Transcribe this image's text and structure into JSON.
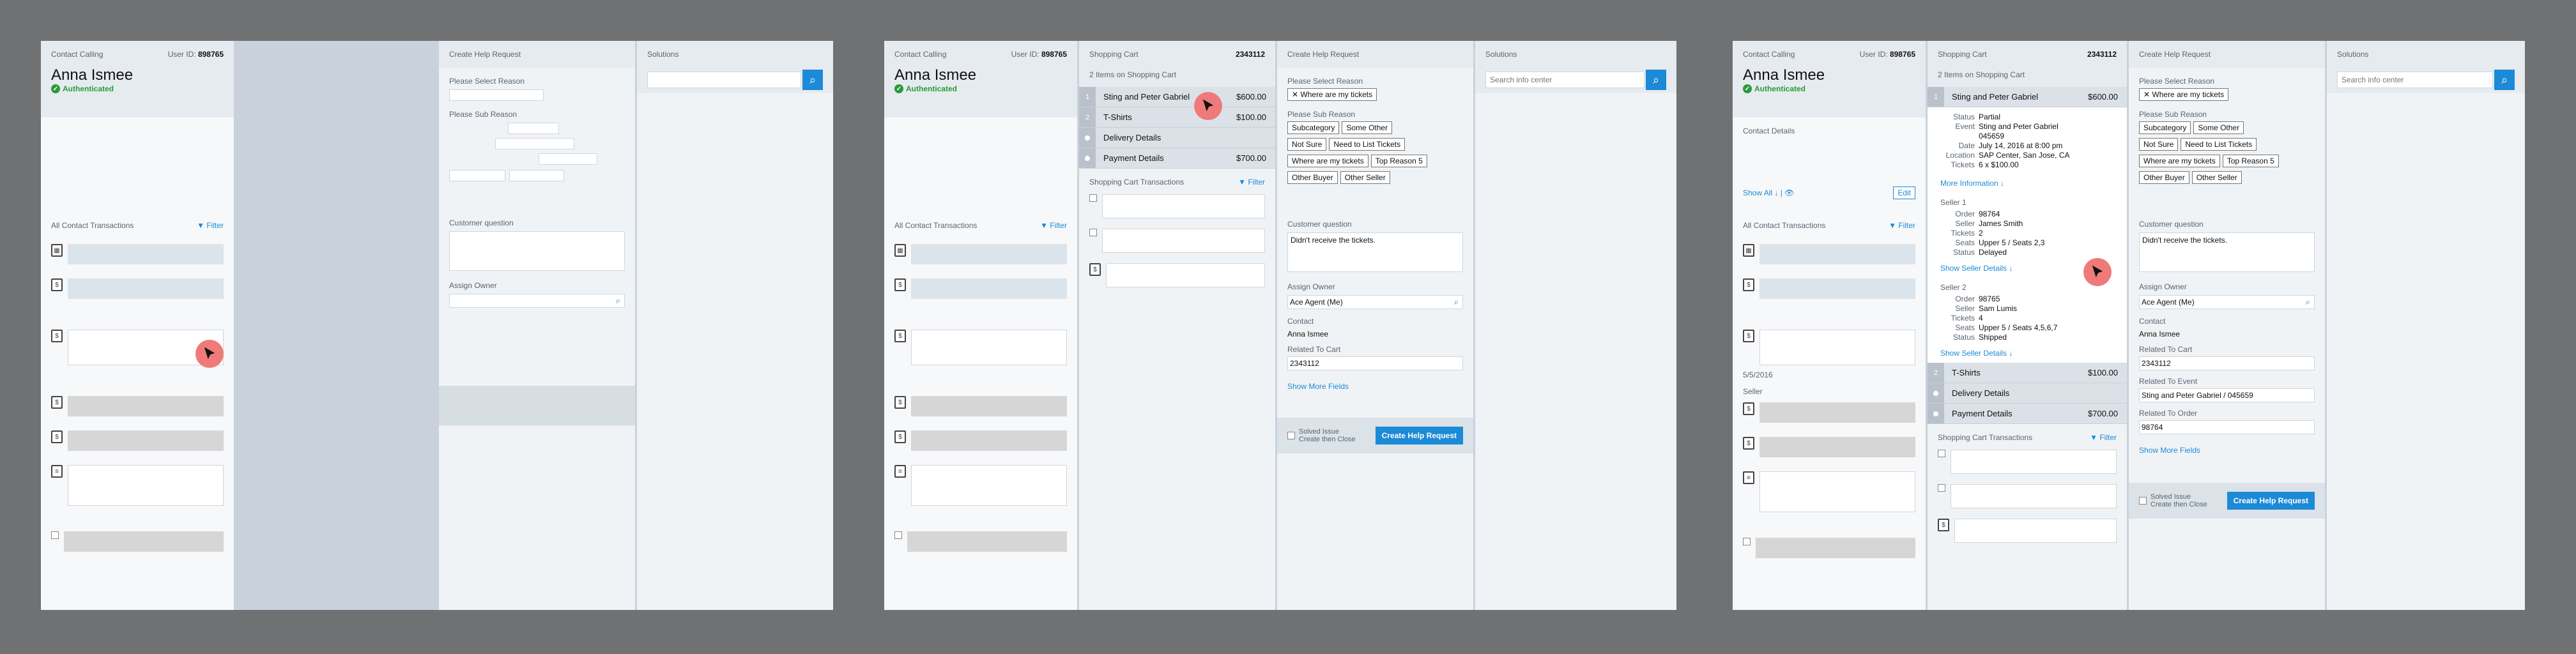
{
  "contact_header": {
    "title": "Contact Calling",
    "user_id_label": "User ID:",
    "user_id": "898765",
    "name": "Anna Ismee",
    "status": "Authenticated"
  },
  "transactions": {
    "title": "All Contact Transactions",
    "filter": "Filter"
  },
  "help": {
    "title": "Create Help Request",
    "reason_label": "Please Select Reason",
    "subreason_label": "Please Sub Reason",
    "question_label": "Customer question",
    "owner_label": "Assign Owner",
    "selected_reason": "Where are my tickets",
    "subreasons": [
      "Subcategory",
      "Some Other",
      "Not Sure",
      "Need to List Tickets",
      "Where are my tickets",
      "Top Reason 5",
      "Other Buyer",
      "Other Seller"
    ],
    "question": "Didn't receive the tickets.",
    "owner": "Ace Agent (Me)",
    "contact_label": "Contact",
    "contact": "Anna Ismee",
    "cart_label": "Related To Cart",
    "cart": "2343112",
    "event_label": "Related To Event",
    "event": "Sting and Peter Gabriel / 045659",
    "order_label": "Related To Order",
    "order": "98764",
    "more_fields": "Show More Fields",
    "solved": "Solved Issue",
    "create_close": "Create then Close",
    "create_btn": "Create Help Request"
  },
  "solutions": {
    "title": "Solutions",
    "placeholder": "Search info center"
  },
  "cart": {
    "title": "Shopping Cart",
    "id": "2343112",
    "count": "2 Items on Shopping Cart",
    "items": [
      {
        "num": "1",
        "name": "Sting and Peter Gabriel",
        "price": "$600.00"
      },
      {
        "num": "2",
        "name": "T-Shirts",
        "price": "$100.00"
      }
    ],
    "delivery": "Delivery Details",
    "payment": "Payment Details",
    "payment_price": "$700.00",
    "tx_title": "Shopping Cart Transactions",
    "filter": "Filter"
  },
  "details": {
    "contact_details": "Contact Details",
    "show_all": "Show All",
    "edit": "Edit",
    "date": "5/5/2016",
    "seller_section": "Seller",
    "status_label": "Status",
    "status": "Partial",
    "event_label": "Event",
    "event": "Sting and Peter Gabriel 045659",
    "date_label": "Date",
    "date_val": "July 14, 2016 at 8:00 pm",
    "location_label": "Location",
    "location": "SAP Center, San Jose, CA",
    "tickets_label": "Tickets",
    "tickets": "6 x $100.00",
    "more_info": "More Information",
    "seller1": "Seller 1",
    "s1_order": "98764",
    "s1_seller": "James Smith",
    "s1_tickets": "2",
    "s1_seats": "Upper 5 / Seats 2,3",
    "s1_status": "Delayed",
    "show_seller": "Show Seller Details",
    "seller2": "Seller 2",
    "s2_order": "98765",
    "s2_seller": "Sam Lumis",
    "s2_tickets": "4",
    "s2_seats": "Upper 5 / Seats 4,5,6,7",
    "s2_status": "Shipped",
    "order_label": "Order",
    "seller_label": "Seller",
    "tickets_lbl": "Tickets",
    "seats_label": "Seats"
  }
}
